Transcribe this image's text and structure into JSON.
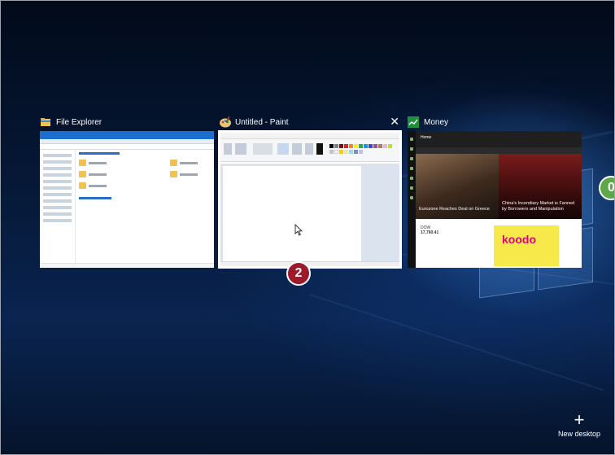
{
  "task_view": {
    "windows": [
      {
        "title": "File Explorer",
        "icon": "folder-icon"
      },
      {
        "title": "Untitled - Paint",
        "icon": "paint-icon",
        "close_label": "✕"
      },
      {
        "title": "Money",
        "icon": "money-icon",
        "home_label": "Home",
        "headline_left": "Eurozone Reaches Deal on Greece",
        "headline_right": "China's Incendiary Market is Fanned by Borrowers and Manipulation",
        "ad_brand": "koodo",
        "quote_label": "DOW",
        "quote_value": "17,760.41"
      }
    ],
    "new_desktop_label": "New desktop",
    "new_desktop_icon": "plus-icon"
  },
  "callouts": {
    "step_2": "2",
    "step_3_partial": "0"
  },
  "colors": {
    "background": "#06142a",
    "callout_red": "#9c1a2a",
    "callout_green": "#5fa84a",
    "explorer_blue": "#1a6fd1",
    "koodo_yellow": "#f7e94a",
    "koodo_pink": "#e6007e"
  }
}
